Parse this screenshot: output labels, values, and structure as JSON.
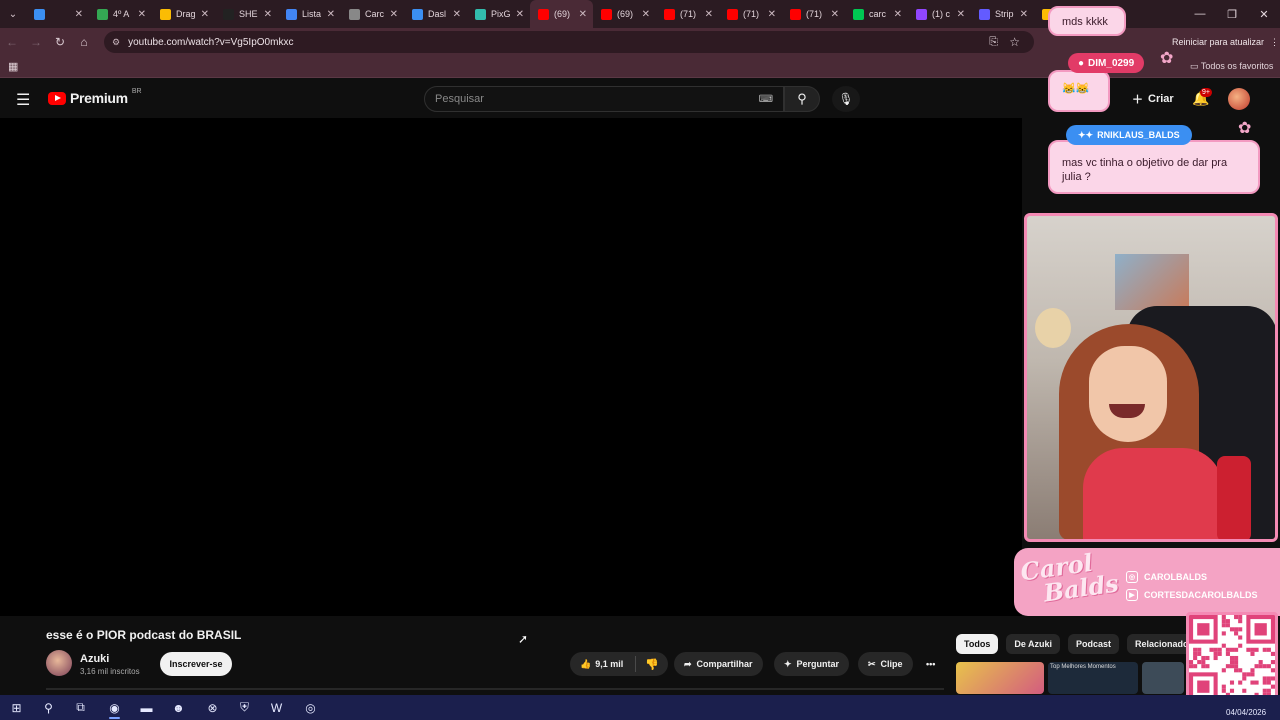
{
  "browser": {
    "tabs": [
      {
        "label": "",
        "color": "#3b8ff2"
      },
      {
        "label": "4º A",
        "color": "#34a853"
      },
      {
        "label": "Drag",
        "color": "#fbbc04"
      },
      {
        "label": "SHE",
        "color": "#222222"
      },
      {
        "label": "Lista",
        "color": "#4285f4"
      },
      {
        "label": "Carc",
        "color": "#888888"
      },
      {
        "label": "Dasl",
        "color": "#3b8ff2"
      },
      {
        "label": "PixG",
        "color": "#32bcad"
      },
      {
        "label": "(69)",
        "color": "#ff0000"
      },
      {
        "label": "(69)",
        "color": "#ff0000"
      },
      {
        "label": "(71)",
        "color": "#ff0000"
      },
      {
        "label": "(71)",
        "color": "#ff0000"
      },
      {
        "label": "(71)",
        "color": "#ff0000"
      },
      {
        "label": "carc",
        "color": "#00c853"
      },
      {
        "label": "(1) c",
        "color": "#9146ff"
      },
      {
        "label": "Strip",
        "color": "#635bff"
      },
      {
        "label": "carc",
        "color": "#fbbc04"
      }
    ],
    "url": "youtube.com/watch?v=Vg5IpO0mkxc",
    "restart_label": "Reiniciar para atualizar",
    "favorites_label": "Todos os favoritos"
  },
  "youtube": {
    "brand": "Premium",
    "region": "BR",
    "search_placeholder": "Pesquisar",
    "create_label": "Criar",
    "notif_count": "9+",
    "video": {
      "title": "esse é o PIOR podcast do BRASIL",
      "channel": "Azuki",
      "subscribers": "3,16 mil inscritos",
      "subscribe_label": "Inscrever-se",
      "likes": "9,1 mil",
      "share_label": "Compartilhar",
      "ask_label": "Perguntar",
      "clip_label": "Clipe"
    },
    "chips": [
      "Todos",
      "De Azuki",
      "Podcast",
      "Relacionados"
    ],
    "thumb_text": "Top Melhores Momentos"
  },
  "overlay": {
    "message1": "mds kkkk",
    "user1": "DIM_0299",
    "user2": "RNIKLAUS_BALDS",
    "message2": "mas vc tinha o objetivo de dar pra julia ?",
    "logo_line1": "Carol",
    "logo_line2": "Balds",
    "social1": "CAROLBALDS",
    "social2": "CORTESDACAROLBALDS"
  },
  "taskbar": {
    "date": "04/04/2026"
  }
}
